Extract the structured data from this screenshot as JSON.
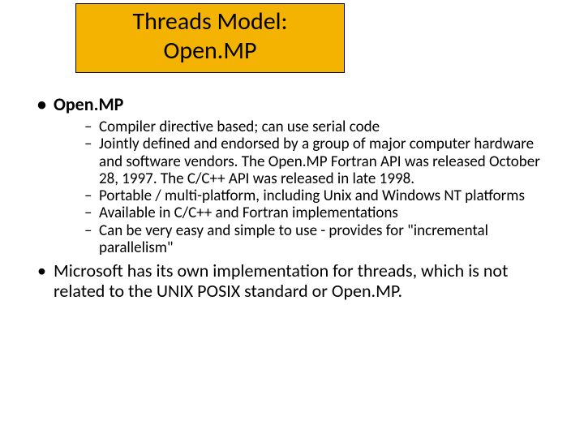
{
  "title_line1": "Threads Model:",
  "title_line2": "Open.MP",
  "main": {
    "heading": "Open.MP",
    "sub_items": [
      "Compiler directive based; can use serial code",
      "Jointly defined and endorsed by a group of major computer hardware and software vendors. The Open.MP Fortran API was released October 28, 1997. The C/C++ API was released in late 1998.",
      "Portable / multi-platform, including Unix and Windows NT platforms",
      "Available in C/C++ and Fortran implementations",
      "Can be very easy and simple to use - provides for \"incremental parallelism\""
    ],
    "second_bullet": "Microsoft has its own implementation for threads, which is not related to the UNIX POSIX standard or Open.MP."
  }
}
